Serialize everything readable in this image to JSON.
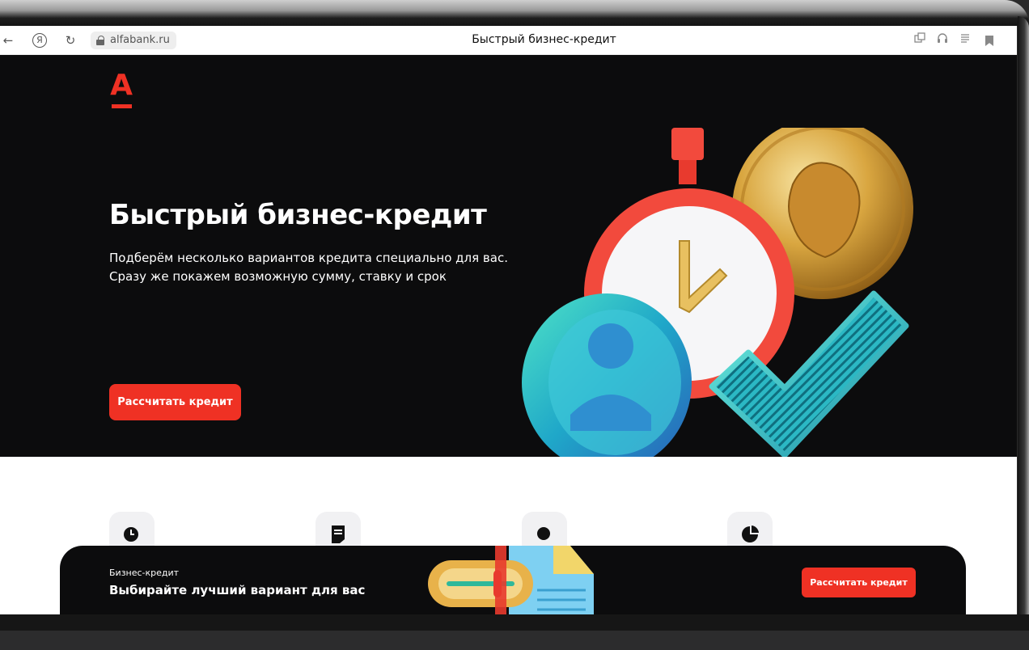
{
  "browser": {
    "url": "alfabank.ru",
    "tab_title": "Быстрый бизнес-кредит",
    "yandex_glyph": "Я",
    "icons": [
      "back-arrow-icon",
      "yandex-icon",
      "reload-icon",
      "lock-icon",
      "tabs-icon",
      "headphones-icon",
      "reader-icon",
      "bookmark-icon"
    ]
  },
  "hero": {
    "logo_letter": "А",
    "title": "Быстрый бизнес-кредит",
    "subtitle_line1": "Подберём несколько вариантов кредита специально для вас.",
    "subtitle_line2": "Сразу же покажем возможную сумму, ставку и срок",
    "cta_label": "Рассчитать кредит"
  },
  "banner": {
    "eyebrow": "Бизнес-кредит",
    "title": "Выбирайте лучший вариант для вас",
    "cta_label": "Рассчитать кредит"
  },
  "colors": {
    "brand_red": "#ef3124",
    "hero_bg": "#0c0c0d",
    "page_bg": "#ffffff"
  }
}
